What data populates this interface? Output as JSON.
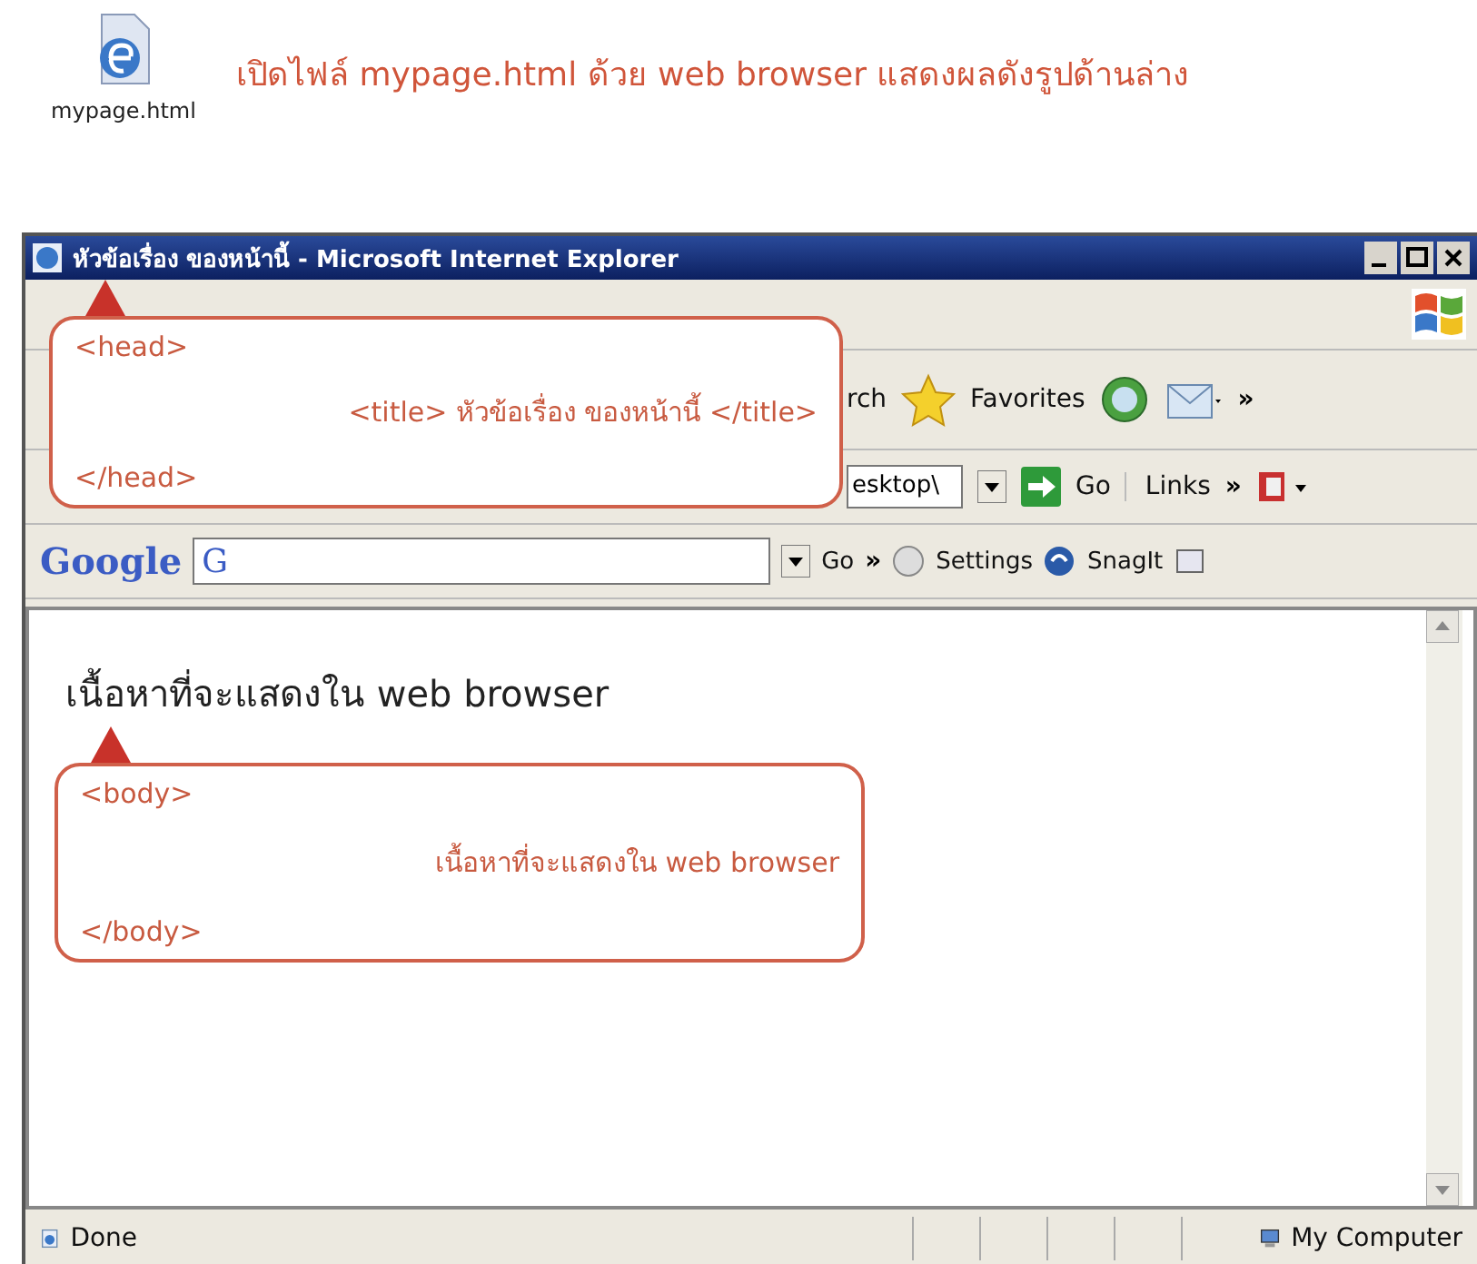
{
  "file_icon": {
    "label": "mypage.html"
  },
  "instruction": "เปิดไฟล์ mypage.html ด้วย web browser แสดงผลดังรูปด้านล่าง",
  "window": {
    "title": "หัวข้อเรื่อง ของหน้านี้ - Microsoft Internet Explorer"
  },
  "toolbar": {
    "search_partial": "rch",
    "favorites": "Favorites",
    "more": "»"
  },
  "address_bar": {
    "value": "esktop\\",
    "go": "Go",
    "links": "Links",
    "more": "»"
  },
  "google_bar": {
    "logo": "Google",
    "search_g": "G",
    "go": "Go",
    "more": "»",
    "settings": "Settings",
    "snagit": "SnagIt"
  },
  "content": {
    "heading": "เนื้อหาที่จะแสดงใน web browser"
  },
  "callouts": [
    {
      "kind": "head",
      "open": "<head>",
      "inner": "<title> หัวข้อเรื่อง ของหน้านี้ </title>",
      "close": "</head>"
    },
    {
      "kind": "body",
      "open": "<body>",
      "inner": "เนื้อหาที่จะแสดงใน web browser",
      "close": "</body>"
    }
  ],
  "status_bar": {
    "status": "Done",
    "zone": "My Computer"
  }
}
